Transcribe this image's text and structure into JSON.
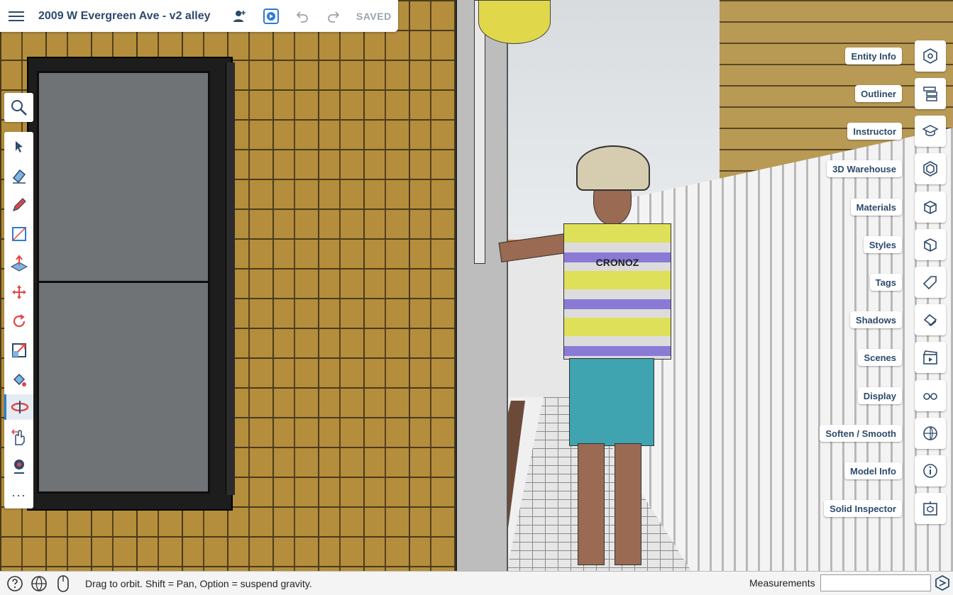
{
  "header": {
    "document_title": "2009 W Evergreen Ave - v2 alley",
    "saved_status": "SAVED",
    "icons": [
      "menu-icon",
      "add-collaborator-icon",
      "present-icon",
      "undo-icon",
      "redo-icon"
    ]
  },
  "left_toolbar": {
    "search_icon": "search-icon",
    "tools": [
      "select-icon",
      "eraser-icon",
      "pencil-icon",
      "rectangle-icon",
      "push-pull-icon",
      "move-icon",
      "rotate-icon",
      "scale-icon",
      "paint-bucket-icon",
      "orbit-icon",
      "pan-icon",
      "position-camera-icon",
      "more-icon"
    ],
    "active_tool": "orbit-icon",
    "more_label": "···"
  },
  "right_panel": {
    "items": [
      {
        "label": "Entity Info",
        "icon": "entity-info-icon"
      },
      {
        "label": "Outliner",
        "icon": "outliner-icon"
      },
      {
        "label": "Instructor",
        "icon": "instructor-icon"
      },
      {
        "label": "3D Warehouse",
        "icon": "warehouse-icon"
      },
      {
        "label": "Materials",
        "icon": "materials-icon"
      },
      {
        "label": "Styles",
        "icon": "styles-icon"
      },
      {
        "label": "Tags",
        "icon": "tags-icon"
      },
      {
        "label": "Shadows",
        "icon": "shadows-icon"
      },
      {
        "label": "Scenes",
        "icon": "scenes-icon"
      },
      {
        "label": "Display",
        "icon": "display-icon"
      },
      {
        "label": "Soften / Smooth",
        "icon": "soften-smooth-icon"
      },
      {
        "label": "Model Info",
        "icon": "model-info-icon"
      },
      {
        "label": "Solid Inspector",
        "icon": "solid-inspector-icon"
      }
    ]
  },
  "statusbar": {
    "hint": "Drag to orbit. Shift = Pan, Option = suspend gravity.",
    "measurements_label": "Measurements",
    "measurements_value": "",
    "icons": [
      "help-icon",
      "globe-icon",
      "mouse-icon",
      "sketchup-logo-icon"
    ]
  },
  "scene": {
    "shirt_text": "CRONOZ"
  },
  "colors": {
    "accent": "#2d4a6b",
    "active_tool_bg": "#e4ecf3",
    "brick": "#b48e3c"
  }
}
